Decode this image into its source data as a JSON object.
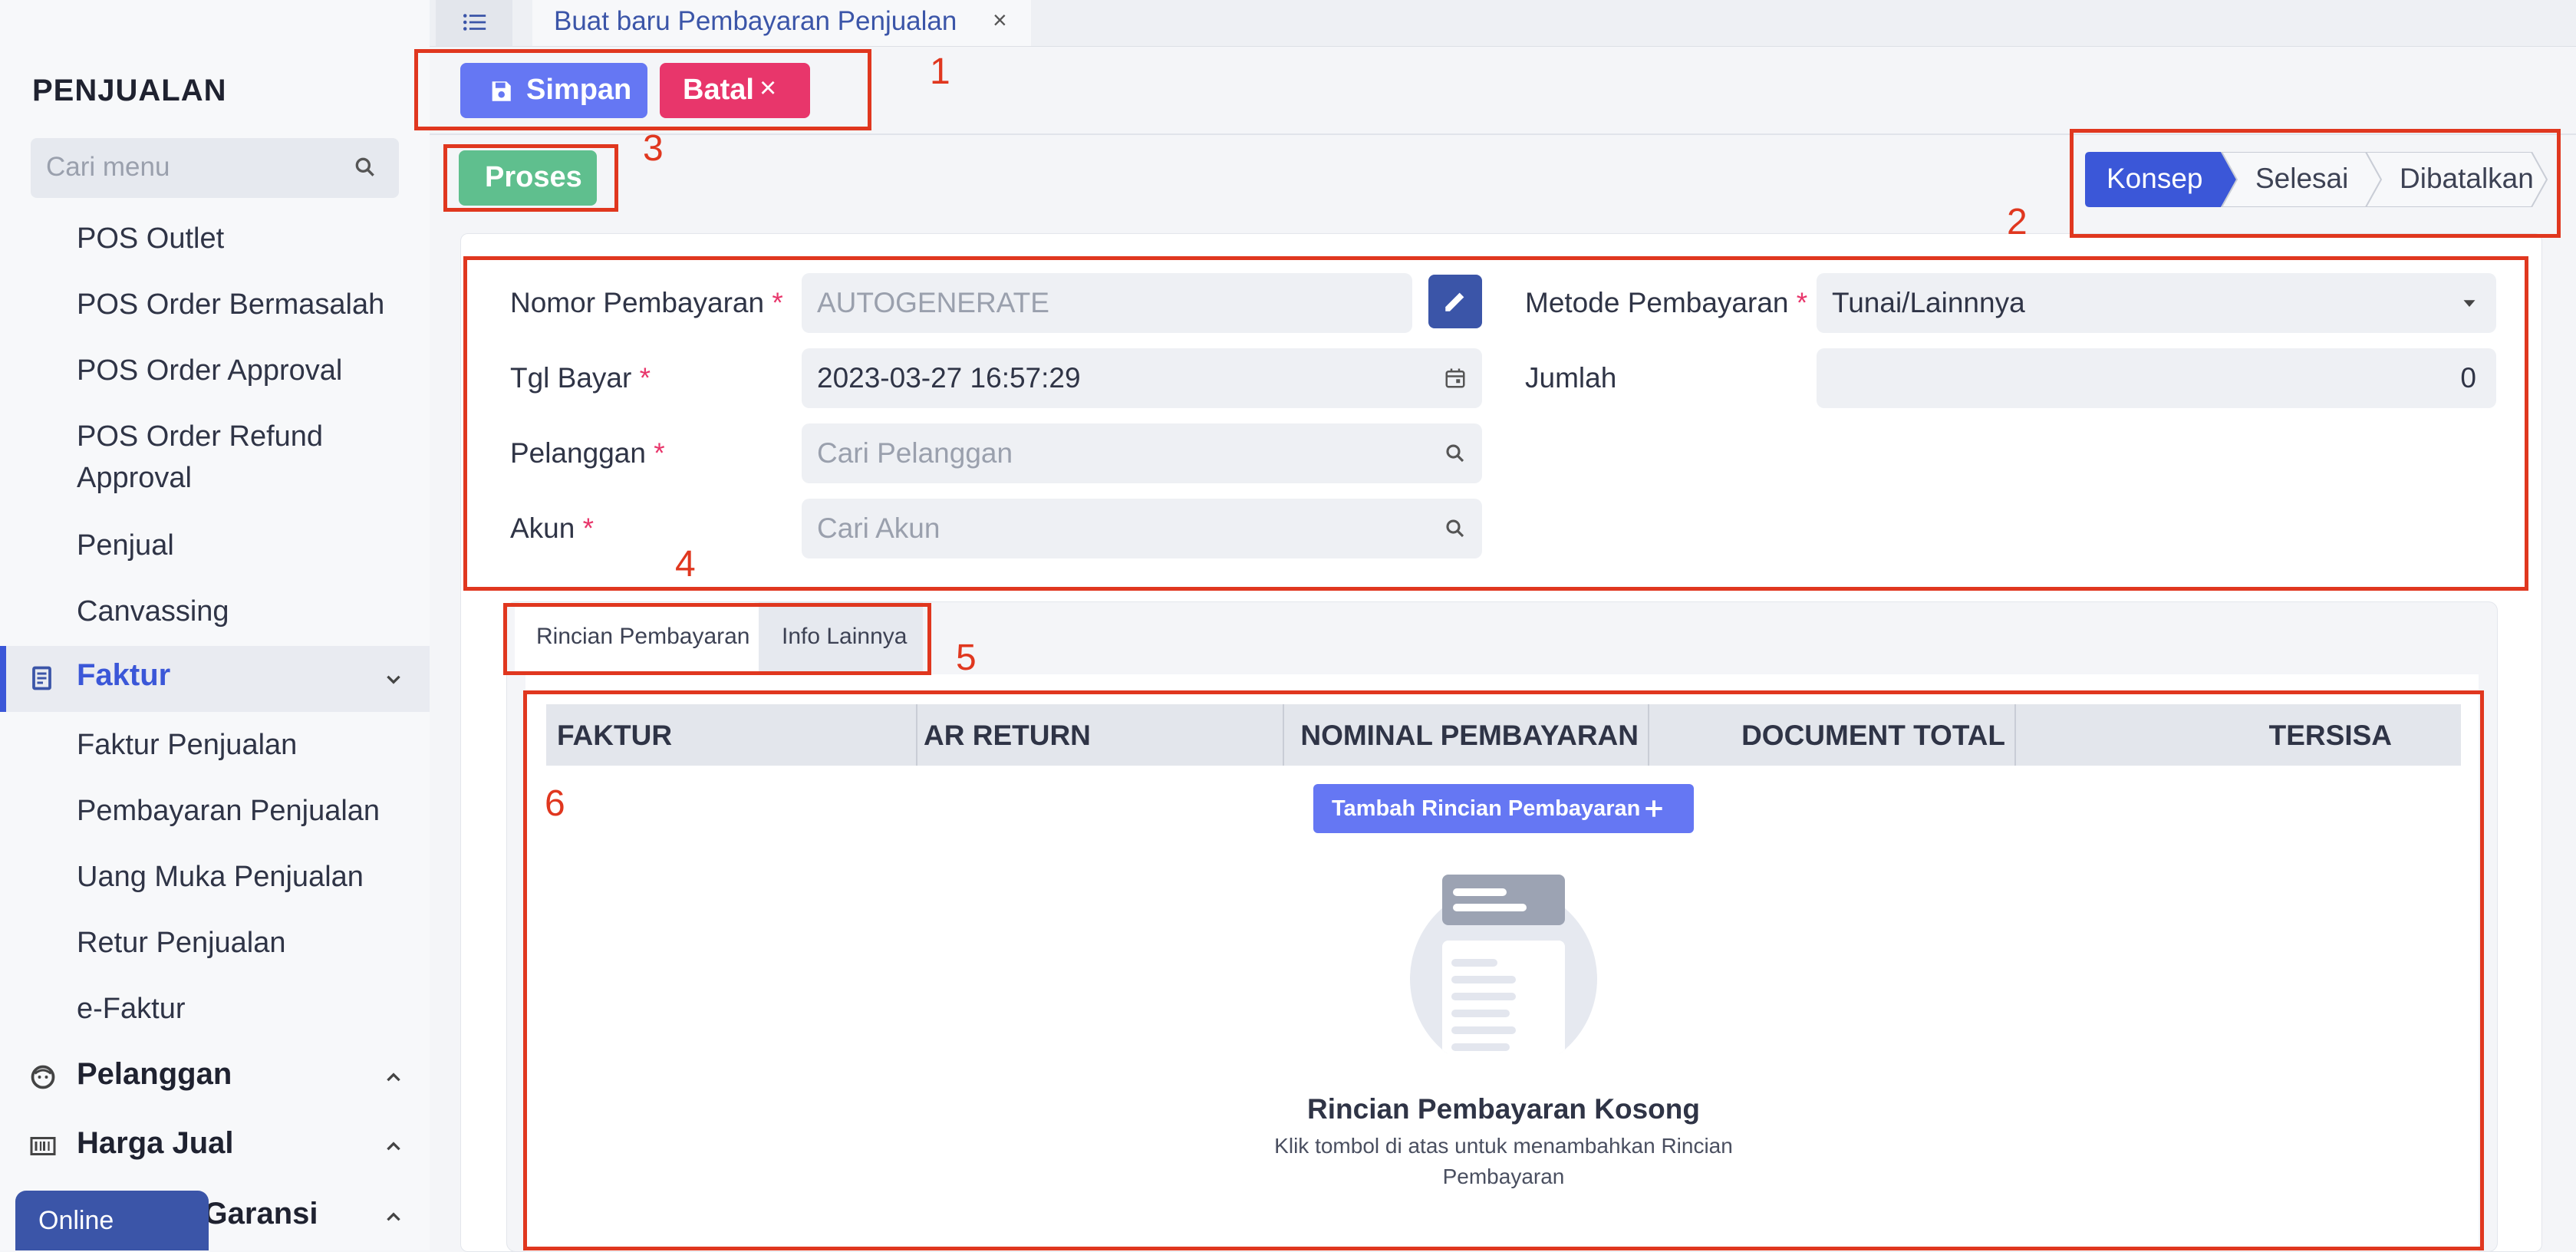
{
  "sidebar": {
    "title": "PENJUALAN",
    "search_placeholder": "Cari menu",
    "items": [
      {
        "label": "POS Outlet"
      },
      {
        "label": "POS Order Bermasalah"
      },
      {
        "label": "POS Order Approval"
      },
      {
        "label": "POS Order Refund"
      },
      {
        "label": "Approval"
      },
      {
        "label": "Penjual"
      },
      {
        "label": "Canvassing"
      }
    ],
    "groups": {
      "faktur": "Faktur",
      "pelanggan": "Pelanggan",
      "harga_jual": "Harga Jual",
      "garansi": "n Garansi"
    },
    "faktur_items": [
      {
        "label": "Faktur Penjualan"
      },
      {
        "label": "Pembayaran Penjualan"
      },
      {
        "label": "Uang Muka Penjualan"
      },
      {
        "label": "Retur Penjualan"
      },
      {
        "label": "e-Faktur"
      }
    ],
    "online_badge": "Online"
  },
  "tabbar": {
    "active_tab": "Buat baru Pembayaran Penjualan",
    "close": "×"
  },
  "toolbar": {
    "save_label": "Simpan",
    "cancel_label": "Batal",
    "cancel_symbol": "×",
    "process_label": "Proses"
  },
  "status_steps": [
    "Konsep",
    "Selesai",
    "Dibatalkan"
  ],
  "form": {
    "nomor_label": "Nomor Pembayaran",
    "nomor_placeholder": "AUTOGENERATE",
    "tgl_label": "Tgl Bayar",
    "tgl_value": "2023-03-27  16:57:29",
    "pelanggan_label": "Pelanggan",
    "pelanggan_placeholder": "Cari Pelanggan",
    "akun_label": "Akun",
    "akun_placeholder": "Cari Akun",
    "metode_label": "Metode Pembayaran",
    "metode_value": "Tunai/Lainnnya",
    "jumlah_label": "Jumlah",
    "jumlah_value": "0",
    "required_mark": "*"
  },
  "tabs": {
    "rincian": "Rincian Pembayaran",
    "info": "Info Lainnya"
  },
  "table": {
    "headers": [
      "FAKTUR",
      "AR RETURN",
      "NOMINAL PEMBAYARAN",
      "DOCUMENT TOTAL",
      "TERSISA"
    ],
    "add_button": "Tambah Rincian Pembayaran",
    "empty_title": "Rincian Pembayaran Kosong",
    "empty_desc": "Klik tombol di atas untuk menambahkan Rincian Pembayaran"
  },
  "annotations": [
    "1",
    "2",
    "3",
    "4",
    "5",
    "6"
  ],
  "colors": {
    "primary": "#6577f3",
    "danger": "#e8366b",
    "success": "#5fbf8e",
    "nav_active": "#3b57d8",
    "annotation": "#e0371f"
  }
}
